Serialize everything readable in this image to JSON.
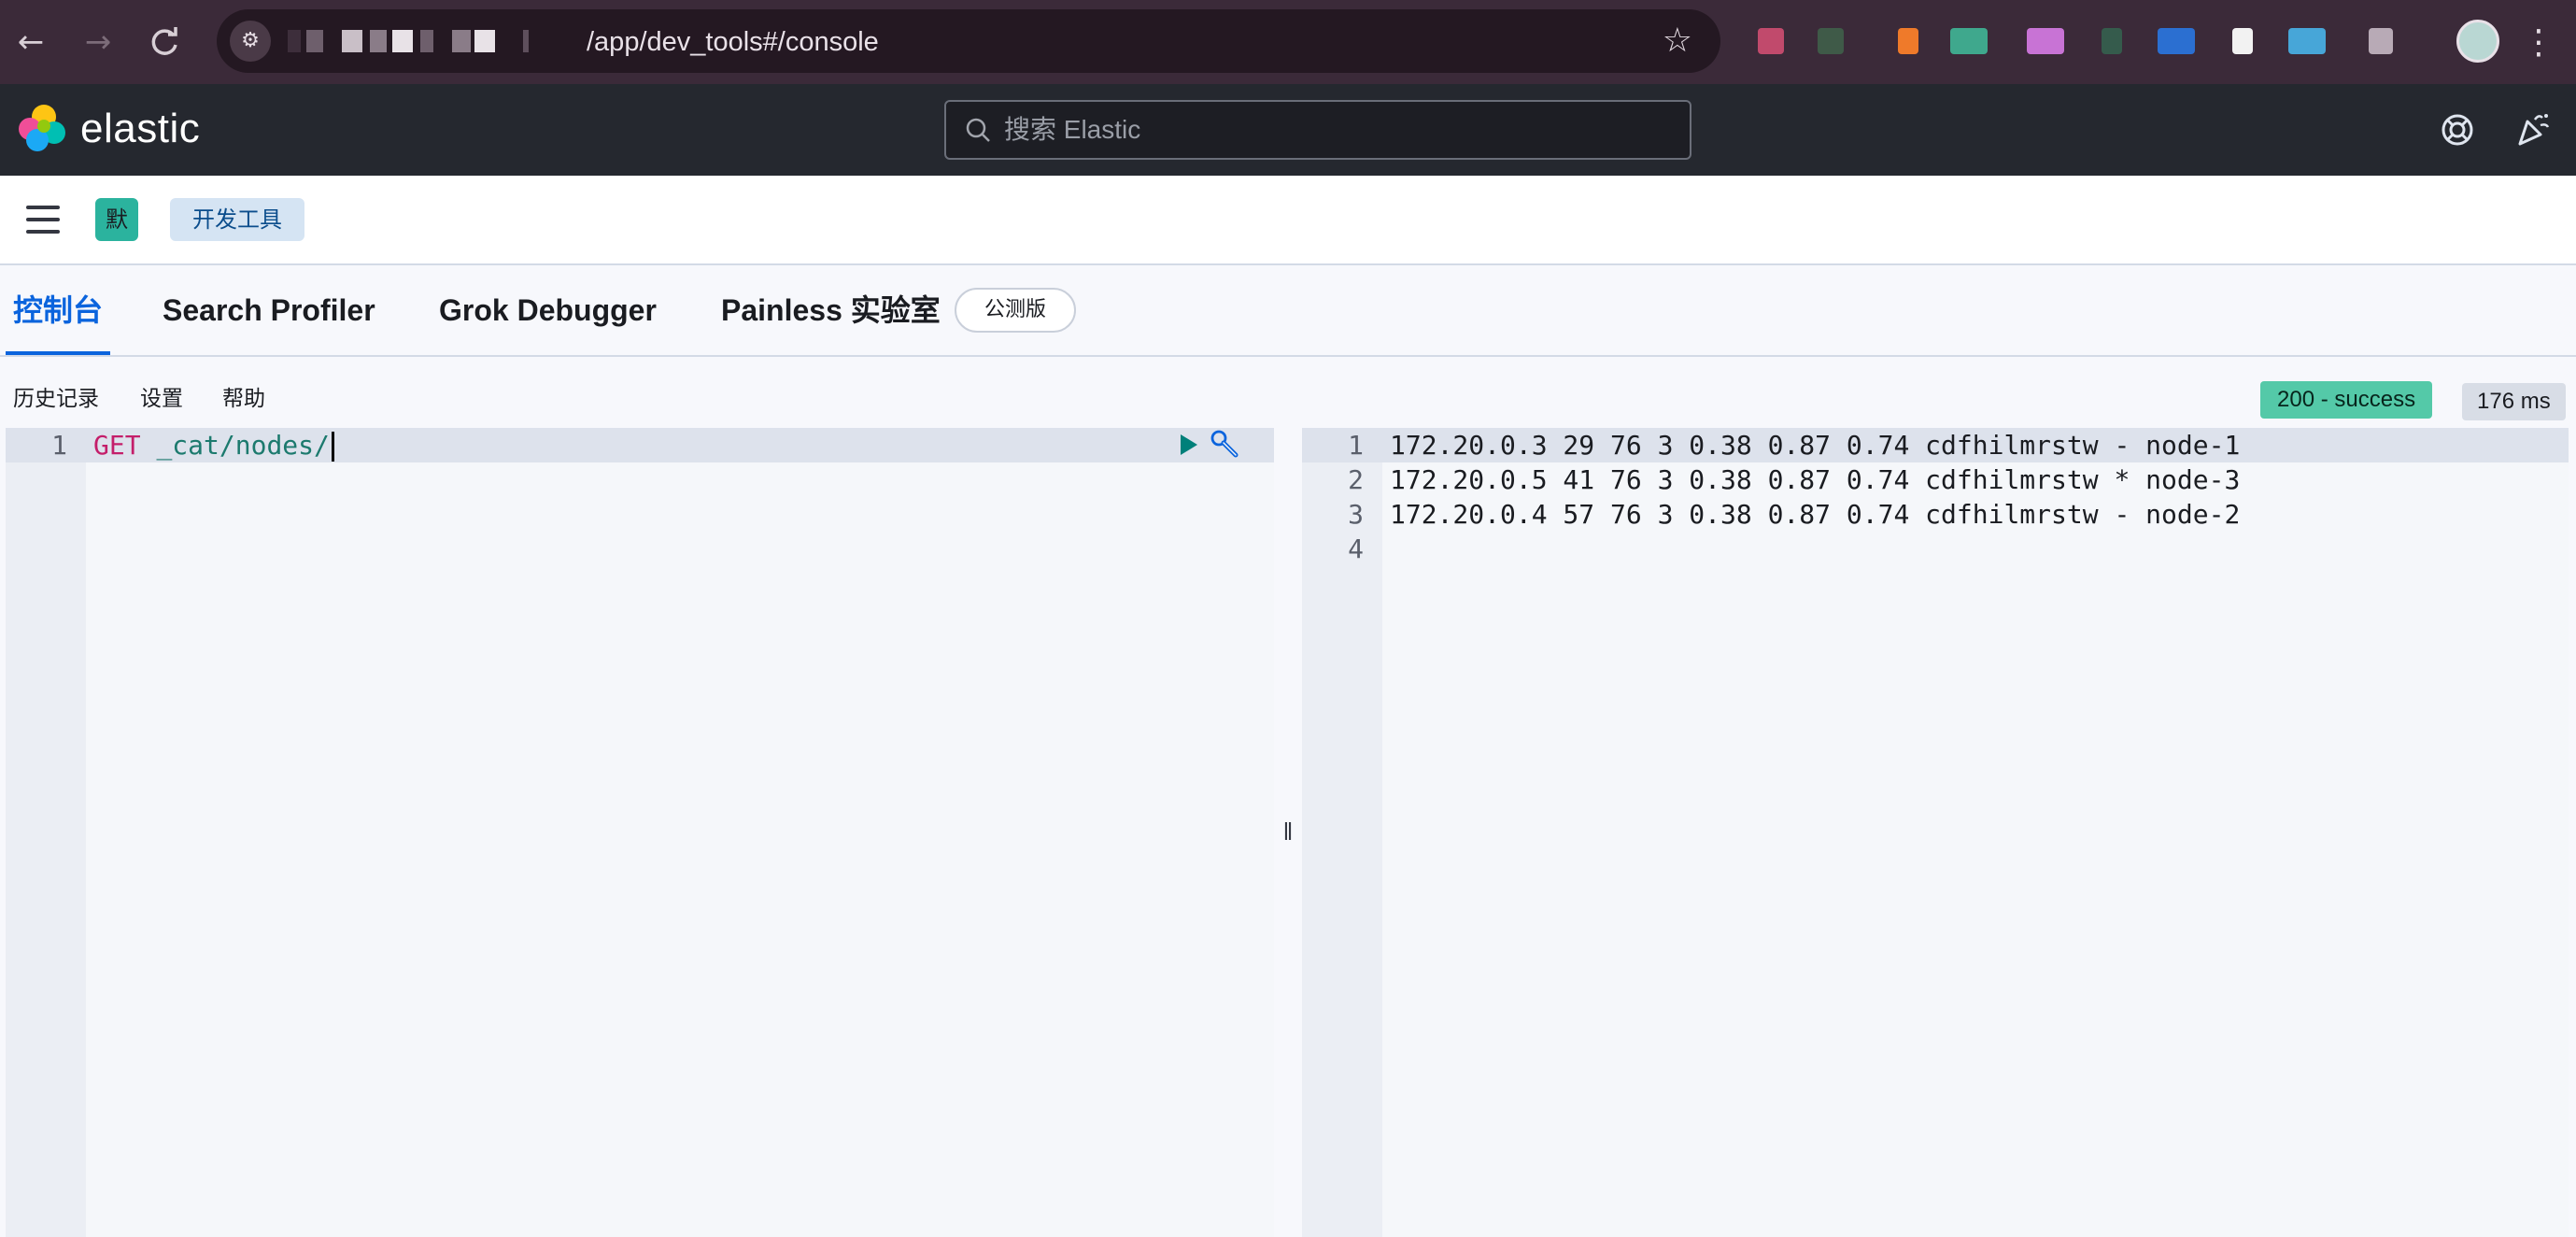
{
  "browser": {
    "url_path": "/app/dev_tools#/console",
    "back_icon": "arrow-left-icon",
    "forward_icon": "arrow-right-icon",
    "reload_icon": "reload-icon",
    "bookmark_icon": "star-icon"
  },
  "header": {
    "brand": "elastic",
    "search_placeholder": "搜索 Elastic"
  },
  "breadcrumbs": {
    "space_initial": "默",
    "current": "开发工具"
  },
  "tabs": [
    {
      "label": "控制台",
      "active": true
    },
    {
      "label": "Search Profiler",
      "active": false
    },
    {
      "label": "Grok Debugger",
      "active": false
    },
    {
      "label": "Painless 实验室",
      "active": false
    }
  ],
  "beta_label": "公测版",
  "toolbar": {
    "history": "历史记录",
    "settings": "设置",
    "help": "帮助",
    "status": "200 - success",
    "duration": "176 ms"
  },
  "request": {
    "lines": [
      {
        "number": "1",
        "method": "GET",
        "path": "_cat/nodes/"
      }
    ]
  },
  "response": {
    "lines": [
      {
        "number": "1",
        "text": "172.20.0.3 29 76 3 0.38 0.87 0.74 cdfhilmrstw - node-1"
      },
      {
        "number": "2",
        "text": "172.20.0.5 41 76 3 0.38 0.87 0.74 cdfhilmrstw * node-3"
      },
      {
        "number": "3",
        "text": "172.20.0.4 57 76 3 0.38 0.87 0.74 cdfhilmrstw - node-2"
      },
      {
        "number": "4",
        "text": ""
      }
    ]
  },
  "colors": {
    "accent": "#0b64dd",
    "success": "#54c9a8",
    "header_bg": "#25282f",
    "browser_bg": "#3b2a39"
  }
}
